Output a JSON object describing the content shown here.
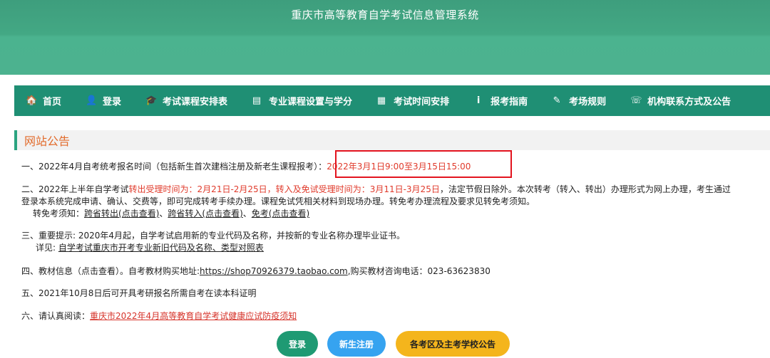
{
  "header": {
    "title": "重庆市高等教育自学考试信息管理系统"
  },
  "nav": [
    {
      "icon": "home-icon",
      "glyph": "🏠",
      "label": "首页"
    },
    {
      "icon": "user-icon",
      "glyph": "👤",
      "label": "登录"
    },
    {
      "icon": "graduation-cap-icon",
      "glyph": "🎓",
      "label": "考试课程安排表"
    },
    {
      "icon": "id-card-icon",
      "glyph": "▤",
      "label": "专业课程设置与学分"
    },
    {
      "icon": "calendar-icon",
      "glyph": "▦",
      "label": "考试时间安排"
    },
    {
      "icon": "info-icon",
      "glyph": "i",
      "label": "报考指南"
    },
    {
      "icon": "pencil-icon",
      "glyph": "✎",
      "label": "考场规则"
    },
    {
      "icon": "phone-icon",
      "glyph": "☏",
      "label": "机构联系方式及公告"
    }
  ],
  "notice": {
    "title": "网站公告",
    "p1": {
      "text": "一、2022年4月自考统考报名时间（包括新生首次建档注册及新老生课程报考）：",
      "time": "2022年3月1日9:00至3月15日15:00"
    },
    "p2": {
      "prefix": "二、2022年上半年自学考试",
      "red1": "转出受理时间为：2月21日-2月25日，转入及免试受理时间为：3月11日-3月25日",
      "suffix": "，法定节假日除外。本次转考（转入、转出）办理形式为网上办理，考生通过",
      "line2": "登录本系统完成申请、确认、交费等，即可完成转考手续办理。课程免试凭相关材料到现场办理。转免考办理流程及要求见转免考须知。",
      "line3_prefix": "转免考须知：",
      "link1": "跨省转出(点击查看)",
      "sep1": "、",
      "link2": "跨省转入(点击查看)",
      "sep2": "、",
      "link3": "免考(点击查看)"
    },
    "p3": {
      "line1": "三、重要提示: 2020年4月起，自学考试启用新的专业代码及名称，并按新的专业名称办理毕业证书。",
      "line2_prefix": "详见: ",
      "link": "自学考试重庆市开考专业新旧代码及名称、类型对照表"
    },
    "p4": {
      "prefix": "四、教材信息（点击查看）。自考教材购买地址:",
      "link": "https://shop70926379.taobao.com",
      "suffix": ",购买教材咨询电话：023-63623830"
    },
    "p5": "五、2021年10月8日后可开具考研报名所需自考在读本科证明",
    "p6": {
      "prefix": "六、请认真阅读：",
      "link": "重庆市2022年4月高等教育自学考试健康应试防疫须知"
    }
  },
  "buttons": {
    "login": "登录",
    "register": "新生注册",
    "notice": "各考区及主考学校公告"
  }
}
